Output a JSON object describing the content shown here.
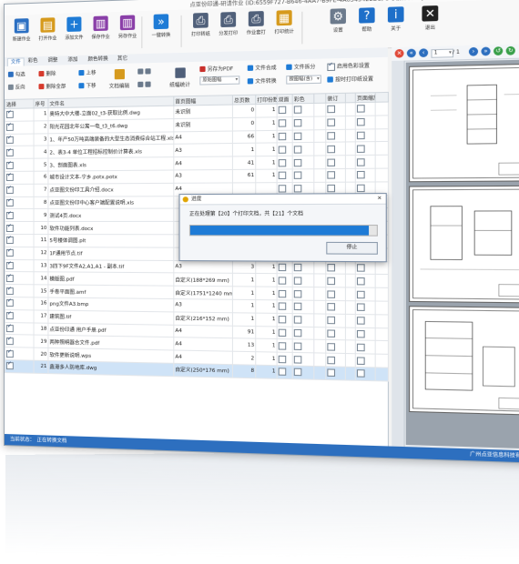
{
  "window": {
    "title": "点亚份印通-研请作业 (ID:6559F727-B646-4AA7-B9FE-4A0345422BC) 5号楼体调图.pit",
    "minimize": "—",
    "maximize": "□",
    "close": "✕"
  },
  "toolbar": {
    "buttons": [
      {
        "label": "新建作业",
        "icon": "new-doc-icon",
        "color": "#2b6fc2",
        "glyph": "▣"
      },
      {
        "label": "打开作业",
        "icon": "open-folder-icon",
        "color": "#d69a1d",
        "glyph": "▤"
      },
      {
        "label": "添加文件",
        "icon": "plus-icon",
        "color": "#1e7bd6",
        "glyph": "+"
      },
      {
        "label": "保存作业",
        "icon": "save-icon",
        "color": "#8a3fa8",
        "glyph": "▥"
      },
      {
        "label": "另存作业",
        "icon": "save-as-icon",
        "color": "#8a3fa8",
        "glyph": "▥"
      },
      {
        "label": "一键转换",
        "icon": "convert-arrow-icon",
        "color": "#1e7bd6",
        "glyph": "»"
      },
      {
        "label": "打印转纸",
        "icon": "print-icon",
        "color": "#50607a",
        "glyph": "⎙"
      },
      {
        "label": "分发打印",
        "icon": "distribute-print-icon",
        "color": "#50607a",
        "glyph": "⎙"
      },
      {
        "label": "作业套打",
        "icon": "batch-print-icon",
        "color": "#50607a",
        "glyph": "⎙"
      },
      {
        "label": "打印统计",
        "icon": "statistics-icon",
        "color": "#d69a1d",
        "glyph": "▦"
      },
      {
        "label": "设置",
        "icon": "gear-icon",
        "color": "#6b7a8c",
        "glyph": "⚙"
      },
      {
        "label": "帮助",
        "icon": "help-icon",
        "color": "#1e6fc9",
        "glyph": "?"
      },
      {
        "label": "关于",
        "icon": "info-icon",
        "color": "#1e6fc9",
        "glyph": "i"
      },
      {
        "label": "退出",
        "icon": "exit-icon",
        "color": "#222222",
        "glyph": "✕"
      }
    ]
  },
  "tabs": [
    "文件",
    "彩色",
    "调整",
    "添加",
    "颜色转换",
    "其它"
  ],
  "ribbon": {
    "select_all": "勾选",
    "delete": "删除",
    "move_up": "上移",
    "reverse": "反向",
    "delete_all": "删除全部",
    "move_down": "下移",
    "doc_edit": "文档编辑",
    "page_stats": "纸幅统计",
    "save_as_pdf": "另存为PDF",
    "original_size": "原始图幅",
    "file_merge": "文件合成",
    "file_split": "文件拆分",
    "file_convert": "文件转换",
    "size_select": "按图幅(含)",
    "enable_color_settings": "启用色彩设置",
    "color_print_setting": "按时打印纸设置"
  },
  "grid": {
    "headers": [
      "选择",
      "序号",
      "文件名",
      "首页图幅",
      "总页数",
      "打印份数",
      "双面",
      "彩色",
      "",
      "装订",
      "",
      "页面缩放",
      ""
    ],
    "rows": [
      {
        "no": "1",
        "name": "奥特大中大楼-立面02_t3-获取比例.dwg",
        "size": "未识别",
        "pages": "0",
        "copies": "1"
      },
      {
        "no": "2",
        "name": "阳光花园北年公寓一电_t3_t6.dwg",
        "size": "未识别",
        "pages": "0",
        "copies": "1"
      },
      {
        "no": "3",
        "name": "1、年产50万吨高端装备的大型生态消费综合站工程.xls",
        "size": "A4",
        "pages": "66",
        "copies": "1"
      },
      {
        "no": "4",
        "name": "2、表3-4 单位工程招标控制价计算表.xls",
        "size": "A3",
        "pages": "1",
        "copies": "1"
      },
      {
        "no": "5",
        "name": "3、剖面图表.xls",
        "size": "A4",
        "pages": "41",
        "copies": "1"
      },
      {
        "no": "6",
        "name": "城市设计文本-宁乡.potx.potx",
        "size": "A3",
        "pages": "61",
        "copies": "1"
      },
      {
        "no": "7",
        "name": "点亚图文份印工具介绍.docx",
        "size": "A4",
        "pages": "",
        "copies": ""
      },
      {
        "no": "8",
        "name": "点亚图文份印中心客户端配置说明.xls",
        "size": "",
        "pages": "",
        "copies": ""
      },
      {
        "no": "9",
        "name": "测试4页.docx",
        "size": "",
        "pages": "",
        "copies": ""
      },
      {
        "no": "10",
        "name": "软件功能列表.docx",
        "size": "",
        "pages": "",
        "copies": ""
      },
      {
        "no": "11",
        "name": "5号楼体调图.plt",
        "size": "",
        "pages": "",
        "copies": ""
      },
      {
        "no": "12",
        "name": "1F通用节点.tif",
        "size": "",
        "pages": "",
        "copies": ""
      },
      {
        "no": "13",
        "name": "3四下9F文件A2,A1,A1 - 副本.tif",
        "size": "A3",
        "pages": "3",
        "copies": "1"
      },
      {
        "no": "14",
        "name": "模版图.pdf",
        "size": "自定义(188*269 mm)",
        "pages": "1",
        "copies": "1"
      },
      {
        "no": "15",
        "name": "手卷平面图.amf",
        "size": "自定义(1751*1240 mm)",
        "pages": "1",
        "copies": "1"
      },
      {
        "no": "16",
        "name": "png文件A3.bmp",
        "size": "A3",
        "pages": "1",
        "copies": "1"
      },
      {
        "no": "17",
        "name": "建筑图.tif",
        "size": "自定义(216*152 mm)",
        "pages": "1",
        "copies": "1"
      },
      {
        "no": "18",
        "name": "点亚份印通 用户手册.pdf",
        "size": "A4",
        "pages": "91",
        "copies": "1"
      },
      {
        "no": "19",
        "name": "两种照明器合文件.pdf",
        "size": "A4",
        "pages": "13",
        "copies": "1"
      },
      {
        "no": "20",
        "name": "软件更新说明.wps",
        "size": "A4",
        "pages": "2",
        "copies": "1"
      },
      {
        "no": "21",
        "name": "鑫港多人防地库.dwg",
        "size": "自定义(250*176 mm)",
        "pages": "8",
        "copies": "1"
      }
    ],
    "selected_row": "21"
  },
  "dialog": {
    "title": "进度",
    "message": "正在处理第【20】个打印文档，共【21】个文档",
    "progress": 0.96,
    "stop_label": "停止"
  },
  "preview": {
    "page_input": "1",
    "page_total": "/ 1"
  },
  "status": {
    "label": "当前状态：",
    "value": "正在转换文档",
    "company": "广州点亚信息科技有限公司"
  },
  "colors": {
    "accent": "#1e7bd6",
    "status_bar": "#2d6fbf",
    "selected_row": "#cfe3f7"
  }
}
